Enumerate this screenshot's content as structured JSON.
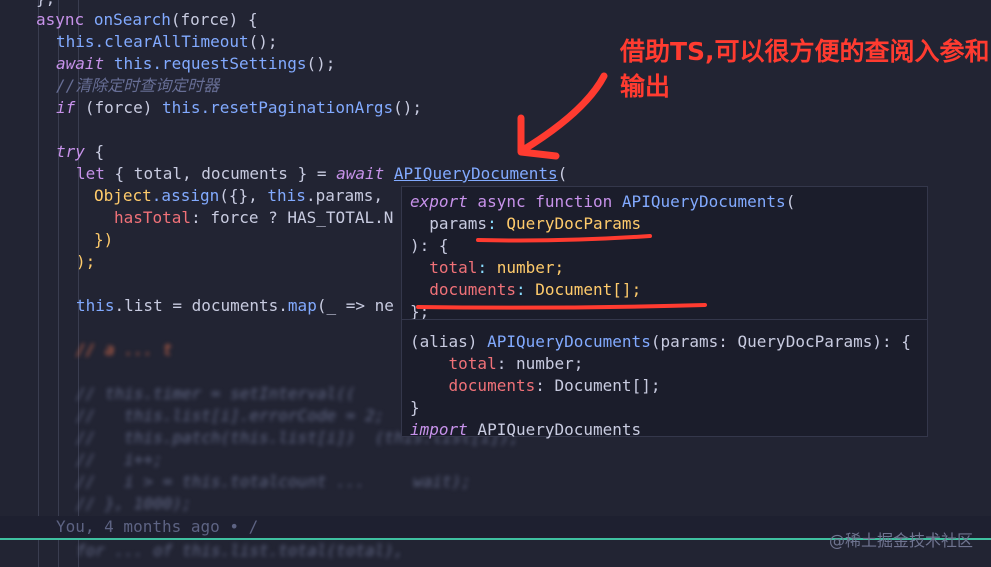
{
  "code": {
    "l0": "};",
    "l1_kw": "async",
    "l1_fn": "onSearch",
    "l1_rest": "(force) {",
    "l2_this": "this",
    "l2_fn": ".clearAllTimeout",
    "l2_rest": "();",
    "l3_kw": "await",
    "l3_this": "this",
    "l3_fn": ".requestSettings",
    "l3_rest": "();",
    "l4_comment": "//清除定时查询定时器",
    "l5_kw": "if",
    "l5_mid": " (force) ",
    "l5_this": "this",
    "l5_fn": ".resetPaginationArgs",
    "l5_rest": "();",
    "l7_kw": "try",
    "l7_rest": " {",
    "l8_kw": "let",
    "l8_mid": " { total, documents } = ",
    "l8_await": "await",
    "l8_fn": "APIQueryDocuments",
    "l8_rest": "(",
    "l9_obj": "Object",
    "l9_fn": ".assign",
    "l9_rest": "({}, ",
    "l9_this": "this",
    "l9_tail": ".params,",
    "l10_prop": "hasTotal",
    "l10_rest": ": force ? HAS_TOTAL.N",
    "l11": "})",
    "l12": ");",
    "l14_this": "this",
    "l14_mid": ".list = documents.",
    "l14_fn": "map",
    "l14_rest": "(_ => ne",
    "blur1": "// this.timer = setInterval((",
    "blur2": "//   this.list[i].errorCode = 2;",
    "blur3": "//   this.patch(this.list[i])  (this.list[i]);",
    "blur4": "//   i++;",
    "blur5": "//   i > = this.totalcount ...     wait);",
    "blur6": "// }, 1000);",
    "blur7": "for ... of this.list.total(total),"
  },
  "hover": {
    "h1_export": "export",
    "h1_async": " async function ",
    "h1_fn": "APIQueryDocuments",
    "h1_rest": "(",
    "h2_param": "  params",
    "h2_colon": ": ",
    "h2_type": "QueryDocParams",
    "h3": "): {",
    "h4_prop": "  total",
    "h4_colon": ": ",
    "h4_type": "number;",
    "h5_prop": "  documents",
    "h5_colon": ": ",
    "h5_type": "Document[];",
    "h6": "};",
    "a1": "(alias) ",
    "a1_fn": "APIQueryDocuments",
    "a1_rest": "(params: QueryDocParams): {",
    "a2_prop": "    total",
    "a2_rest": ": number;",
    "a3_prop": "    documents",
    "a3_rest": ": Document[];",
    "a4": "}",
    "a5_kw": "import",
    "a5_rest": " APIQueryDocuments"
  },
  "annotation": "借助TS,可以很方便的查阅入参和输出",
  "blame": "You, 4 months ago • /",
  "watermark": "@稀土掘金技术社区",
  "colors": {
    "annotation": "#ff3b30",
    "background": "#222433",
    "blame_line": "#3fc0a0"
  }
}
